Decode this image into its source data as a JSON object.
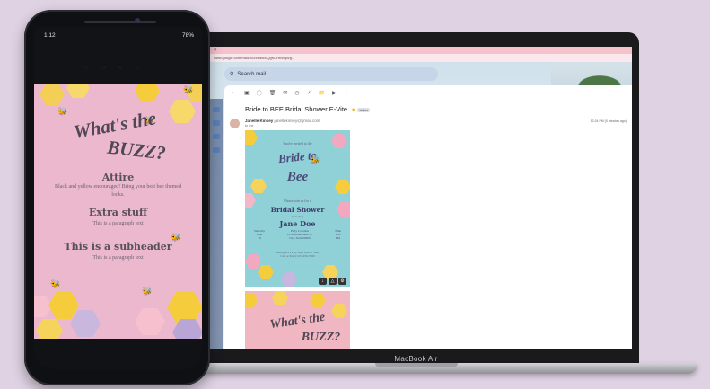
{
  "laptop": {
    "brand": "MacBook Air",
    "browser": {
      "tab_close": "×",
      "tab_add": "+",
      "url": "www.google.com/mail/u/0/#inbox/QgrcJHrhbqWg..."
    },
    "gmail": {
      "search_placeholder": "Search mail",
      "subject": "Bride to BEE Bridal Shower E-Vite",
      "label": "Inbox",
      "sender": "Janelle Kinsey",
      "sender_email": "janellekinsey@gmail.com",
      "to": "to me",
      "timestamp": "12:24 PM (0 minutes ago)"
    },
    "evite": {
      "intro": "You're invited to the",
      "script_1": "Bride to",
      "script_2": "Bee",
      "sub": "Please join us for a",
      "event": "Bridal Shower",
      "honoring": "honoring",
      "name": "Jane Doe",
      "col_left": [
        "Saturday",
        "June",
        "18"
      ],
      "col_mid": [
        "Party Location",
        "1234 Somewhere St.",
        "City, State 00000"
      ],
      "col_right": [
        "Time",
        "1:00",
        "PM"
      ],
      "rsvp": "Kindly RSVP by June 16th to Tara\nCall or Text (123) 456-7890",
      "second_title_1": "What's the",
      "second_title_2": "BUZZ?"
    }
  },
  "phone": {
    "status_time": "1:12",
    "status_right": "78%",
    "title_1": "What's the",
    "title_2": "BUZZ?",
    "sections": [
      {
        "header": "Attire",
        "text": "Black and yellow encouraged! Bring your best bee themed looks."
      },
      {
        "header": "Extra stuff",
        "text": "This is a paragraph text"
      },
      {
        "header": "This is a subheader",
        "text": "This is a paragraph text"
      }
    ]
  },
  "colors": {
    "background": "#dfd2e3",
    "phone_pink": "#ecb8ce",
    "evite_teal": "#8fd1d6",
    "honey_yellow": "#f5cc3c"
  }
}
